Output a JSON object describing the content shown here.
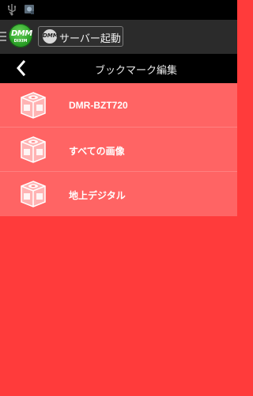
{
  "status_bar": {
    "icons": [
      "usb-icon",
      "notification-icon"
    ]
  },
  "action_bar": {
    "app_logo": {
      "main": "DMM",
      "sub": "DIXIM"
    },
    "server_button": {
      "badge": "DMM",
      "label": "サーバー起動"
    }
  },
  "title_bar": {
    "back_icon": "chevron-left-icon",
    "title": "ブックマーク編集"
  },
  "bookmarks": [
    {
      "label": "DMR-BZT720",
      "icon": "server-box-icon"
    },
    {
      "label": "すべての画像",
      "icon": "server-box-icon"
    },
    {
      "label": "地上デジタル",
      "icon": "server-box-icon"
    }
  ],
  "colors": {
    "list_background": "#ff6464",
    "page_background": "#ff3b3b",
    "divider": "#ff8080"
  }
}
